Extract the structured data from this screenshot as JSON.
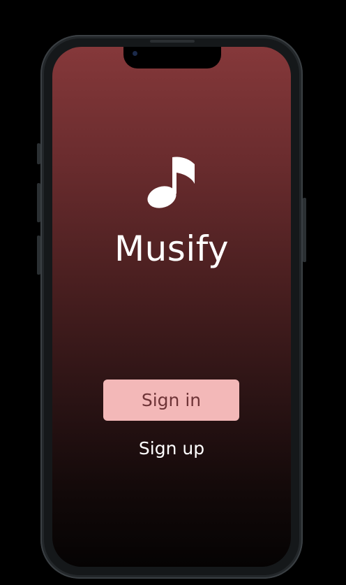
{
  "app": {
    "title": "Musify",
    "logo_icon": "music-note-icon"
  },
  "actions": {
    "sign_in_label": "Sign in",
    "sign_up_label": "Sign up"
  },
  "colors": {
    "gradient_top": "#85383a",
    "gradient_bottom": "#050303",
    "button_bg": "#f3b8b8",
    "button_text": "#6e3437",
    "text": "#ffffff"
  }
}
